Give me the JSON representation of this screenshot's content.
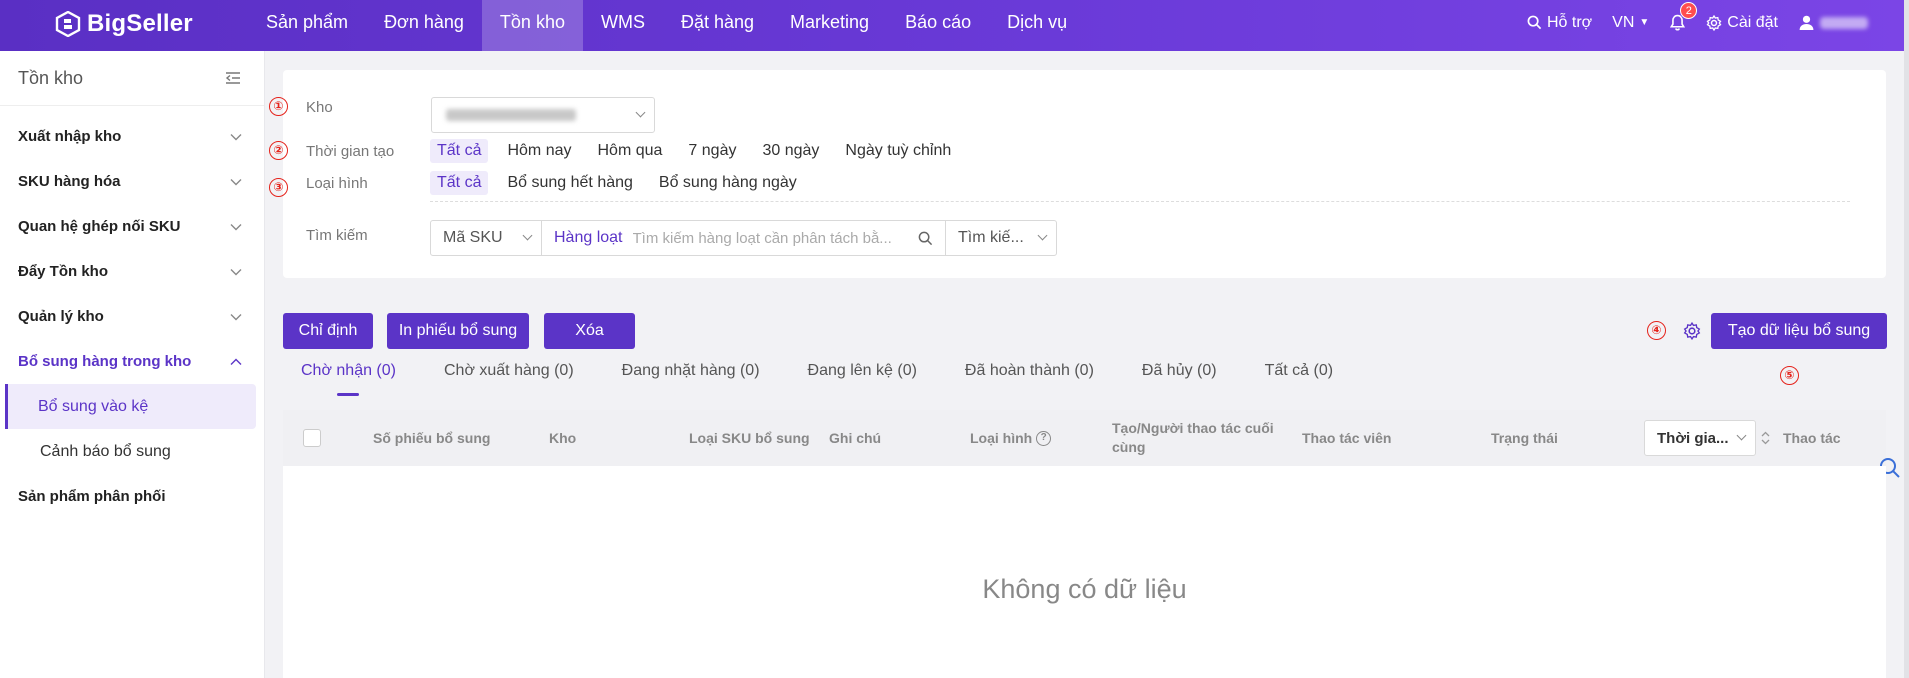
{
  "brand": {
    "name": "BigSeller"
  },
  "nav": {
    "items": [
      "Sản phẩm",
      "Đơn hàng",
      "Tồn kho",
      "WMS",
      "Đặt hàng",
      "Marketing",
      "Báo cáo",
      "Dịch vụ"
    ],
    "active_index": 2
  },
  "topright": {
    "support": "Hỗ trợ",
    "language": "VN",
    "notifications": "2",
    "settings": "Cài đặt"
  },
  "sidebar": {
    "title": "Tồn kho",
    "items": [
      {
        "label": "Xuất nhập kho"
      },
      {
        "label": "SKU hàng hóa"
      },
      {
        "label": "Quan hệ ghép nối SKU"
      },
      {
        "label": "Đẩy Tồn kho"
      },
      {
        "label": "Quản lý kho"
      },
      {
        "label": "Bổ sung hàng trong kho"
      }
    ],
    "subitems": [
      "Bổ sung vào kệ",
      "Cảnh báo bổ sung"
    ],
    "last_item": "Sản phẩm phân phối"
  },
  "filters": {
    "warehouse_label": "Kho",
    "time_label": "Thời gian tạo",
    "time_options": [
      "Tất cả",
      "Hôm nay",
      "Hôm qua",
      "7 ngày",
      "30 ngày",
      "Ngày tuỳ chỉnh"
    ],
    "type_label": "Loại hình",
    "type_options": [
      "Tất cả",
      "Bổ sung hết hàng",
      "Bổ sung hàng ngày"
    ],
    "search_label": "Tìm kiếm",
    "search_field": "Mã SKU",
    "batch_label": "Hàng loạt",
    "search_placeholder": "Tìm kiếm hàng loạt cần phân tách bằ...",
    "search_mode": "Tìm kiế..."
  },
  "markers": [
    "①",
    "②",
    "③",
    "④",
    "⑤"
  ],
  "actions": {
    "assign": "Chỉ định",
    "print": "In phiếu bổ sung",
    "delete": "Xóa",
    "create": "Tạo dữ liệu bổ sung"
  },
  "tabs": [
    "Chờ nhận (0)",
    "Chờ xuất hàng (0)",
    "Đang nhặt hàng (0)",
    "Đang lên kệ (0)",
    "Đã hoàn thành (0)",
    "Đã hủy (0)",
    "Tất cả (0)"
  ],
  "table": {
    "columns": {
      "number": "Số phiếu bổ sung",
      "warehouse": "Kho",
      "sku_type": "Loại SKU bổ sung",
      "note": "Ghi chú",
      "type": "Loại hình",
      "creator": "Tạo/Người thao tác cuối cùng",
      "operator": "Thao tác viên",
      "status": "Trạng thái",
      "time_select": "Thời gia...",
      "action": "Thao tác"
    },
    "empty_text": "Không có dữ liệu"
  },
  "colors": {
    "primary": "#5b34c7",
    "marker": "#e5231b"
  }
}
